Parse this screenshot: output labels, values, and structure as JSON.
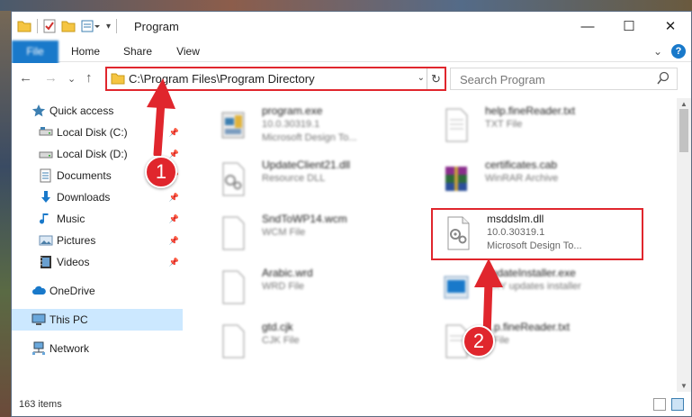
{
  "window": {
    "title": "Program",
    "controls": {
      "minimize": "—",
      "maximize": "☐",
      "close": "✕"
    }
  },
  "ribbon": {
    "tabs": [
      "File",
      "Home",
      "Share",
      "View"
    ],
    "expand": "⌄",
    "help": "?"
  },
  "nav": {
    "back": "←",
    "forward": "→",
    "recent": "⌄",
    "up": "↑",
    "address": "C:\\Program Files\\Program Directory",
    "address_dropdown": "⌄",
    "refresh": "↻",
    "search_placeholder": "Search Program"
  },
  "sidebar": {
    "items": [
      {
        "label": "Quick access",
        "icon": "star-icon",
        "pinned": false
      },
      {
        "label": "Local Disk (C:)",
        "icon": "drive-icon",
        "pinned": true
      },
      {
        "label": "Local Disk (D:)",
        "icon": "drive-icon",
        "pinned": true
      },
      {
        "label": "Documents",
        "icon": "documents-icon",
        "pinned": true
      },
      {
        "label": "Downloads",
        "icon": "downloads-icon",
        "pinned": true
      },
      {
        "label": "Music",
        "icon": "music-icon",
        "pinned": true
      },
      {
        "label": "Pictures",
        "icon": "pictures-icon",
        "pinned": true
      },
      {
        "label": "Videos",
        "icon": "videos-icon",
        "pinned": true
      },
      {
        "label": "OneDrive",
        "icon": "cloud-icon",
        "pinned": false
      },
      {
        "label": "This PC",
        "icon": "pc-icon",
        "pinned": false,
        "selected": true
      },
      {
        "label": "Network",
        "icon": "network-icon",
        "pinned": false
      }
    ]
  },
  "files": [
    {
      "name": "program.exe",
      "line2": "10.0.30319.1",
      "line3": "Microsoft Design To...",
      "icon": "exe-icon"
    },
    {
      "name": "help.fineReader.txt",
      "line2": "TXT File",
      "line3": "",
      "icon": "text-file-icon"
    },
    {
      "name": "UpdateClient21.dll",
      "line2": "Resource DLL",
      "line3": "",
      "icon": "dll-icon"
    },
    {
      "name": "certificates.cab",
      "line2": "WinRAR Archive",
      "line3": "",
      "icon": "archive-icon"
    },
    {
      "name": "SndToWP14.wcm",
      "line2": "WCM File",
      "line3": "",
      "icon": "blank-file-icon"
    },
    {
      "name": "msddslm.dll",
      "line2": "10.0.30319.1",
      "line3": "Microsoft Design To...",
      "icon": "dll-icon"
    },
    {
      "name": "Arabic.wrd",
      "line2": "WRD File",
      "line3": "",
      "icon": "blank-file-icon"
    },
    {
      "name": "updateInstaller.exe",
      "line2": "...XY updates installer",
      "line3": "",
      "icon": "installer-icon"
    },
    {
      "name": "gtd.cjk",
      "line2": "CJK File",
      "line3": "",
      "icon": "blank-file-icon"
    },
    {
      "name": "...p.fineReader.txt",
      "line2": "...File",
      "line3": "",
      "icon": "text-file-icon"
    }
  ],
  "status": {
    "count": "163 items"
  },
  "annotations": {
    "step1": "1",
    "step2": "2"
  },
  "colors": {
    "accent": "#1979ca",
    "highlight": "#e0262d",
    "selected": "#cce8ff"
  }
}
